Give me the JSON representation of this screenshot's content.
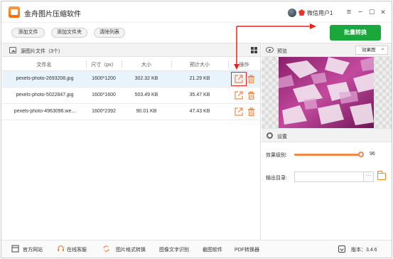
{
  "app": {
    "title": "金舟图片压缩软件",
    "user_name": "微信用户1",
    "window_controls": [
      "≡",
      "−",
      "☐",
      "✕"
    ]
  },
  "toolbar": {
    "add_file": "添加文件",
    "add_folder": "添加文件夹",
    "clear_list": "清除列表",
    "batch_convert": "批量转换"
  },
  "file_list": {
    "title": "源图片文件（3个）",
    "columns": [
      "文件名",
      "尺寸（px）",
      "大小",
      "预计大小",
      "操作"
    ],
    "rows": [
      {
        "name": "pexels-photo-2693208.jpg",
        "size_px": "1600*1200",
        "size": "302.32 KB",
        "est_size": "21.29 KB"
      },
      {
        "name": "pexels-photo-5022847.jpg",
        "size_px": "1600*1600",
        "size": "503.49 KB",
        "est_size": "35.47 KB"
      },
      {
        "name": "pexels-photo-4963096.we...",
        "size_px": "1600*2392",
        "size": "90.01 KB",
        "est_size": "47.43 KB"
      }
    ]
  },
  "preview": {
    "label": "预览",
    "mode": "效果图"
  },
  "settings": {
    "label": "设置",
    "level_label": "效果级别:",
    "level_value": "96",
    "level_fraction": 0.96,
    "outdir_label": "输出目录:",
    "outdir_value": ""
  },
  "footer": {
    "items": [
      "官方网站",
      "在线客服",
      "图片格式转换",
      "图像文字识别",
      "截图软件",
      "PDF转换器"
    ],
    "version": "版本：3.4.6"
  },
  "colors": {
    "accent": "#1aa83c",
    "action_orange": "#f08a4b",
    "annotation_red": "#e8231b"
  }
}
